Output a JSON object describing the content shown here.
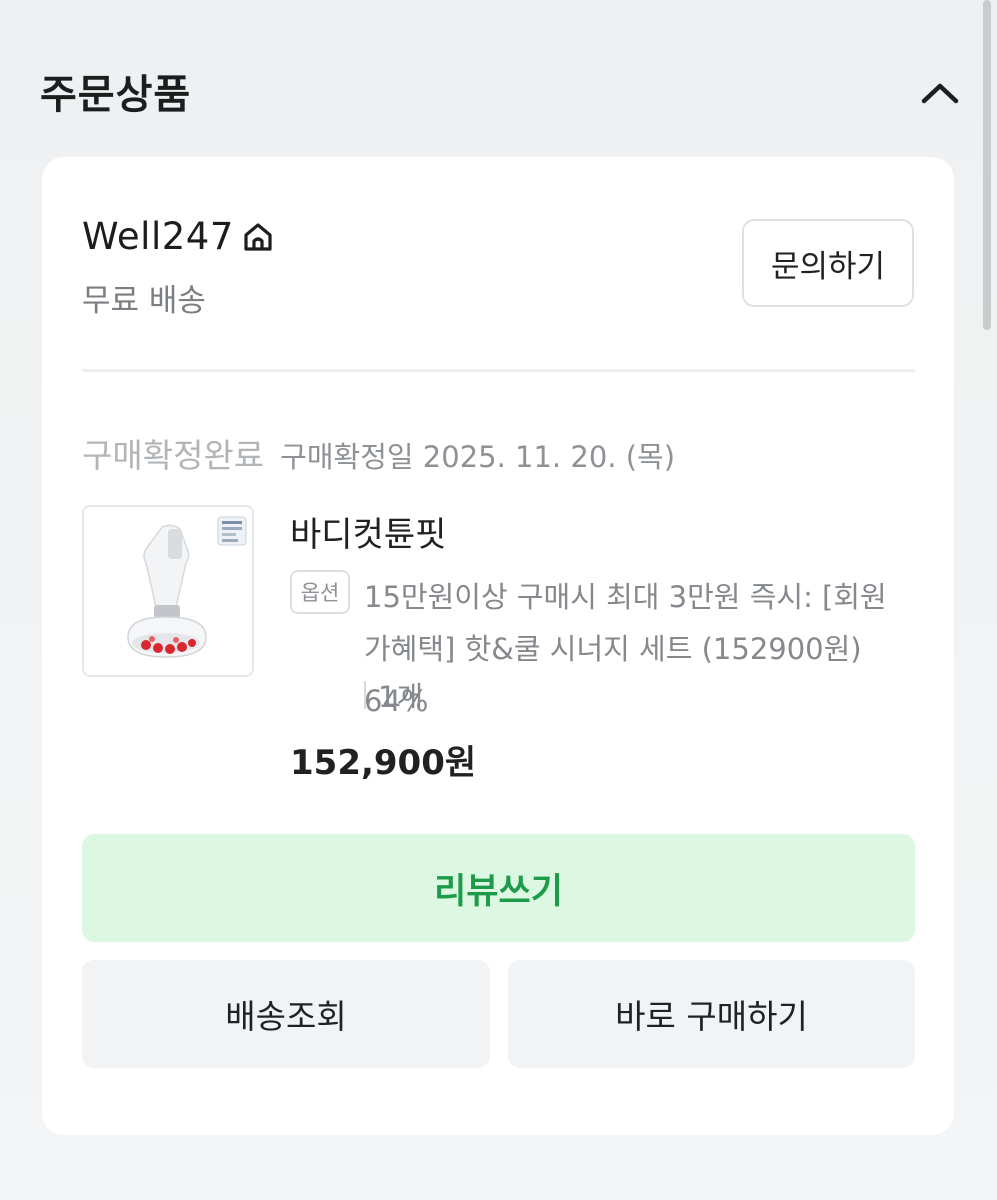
{
  "section": {
    "title": "주문상품"
  },
  "seller": {
    "name": "Well247",
    "shipping": "무료 배송",
    "inquiry_label": "문의하기"
  },
  "order": {
    "status": "구매확정완료",
    "confirm_date": "구매확정일 2025. 11. 20. (목)"
  },
  "product": {
    "name": "바디컷튠핏",
    "option_badge": "옵션",
    "option_text": "15만원이상 구매시 최대 3만원 즉시: [회원가혜택] 핫&쿨 시너지 세트 (152900원) 64%",
    "quantity": "1개",
    "price": "152,900원"
  },
  "actions": {
    "review_label": "리뷰쓰기",
    "track_label": "배송조회",
    "buynow_label": "바로 구매하기"
  },
  "colors": {
    "review_bg": "#dcf8e3",
    "review_text": "#1e9b4a"
  }
}
